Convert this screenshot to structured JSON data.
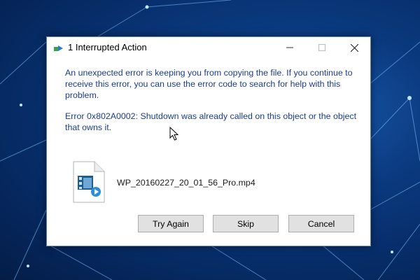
{
  "dialog": {
    "title": "1 Interrupted Action",
    "message": "An unexpected error is keeping you from copying the file. If you continue to receive this error, you can use the error code to search for help with this problem.",
    "error": "Error 0x802A0002: Shutdown was already called on this object or the object that owns it.",
    "file_name": "WP_20160227_20_01_56_Pro.mp4",
    "buttons": {
      "try_again": "Try Again",
      "skip": "Skip",
      "cancel": "Cancel"
    }
  },
  "icons": {
    "title": "copy-interrupted-icon",
    "file": "video-file-icon",
    "minimize": "minimize-icon",
    "maximize": "maximize-icon",
    "close": "close-icon",
    "cursor": "mouse-cursor-icon"
  },
  "colors": {
    "message_text": "#1c3c8c",
    "desktop_background": "#0b3a80",
    "button_face": "#e1e1e1"
  }
}
